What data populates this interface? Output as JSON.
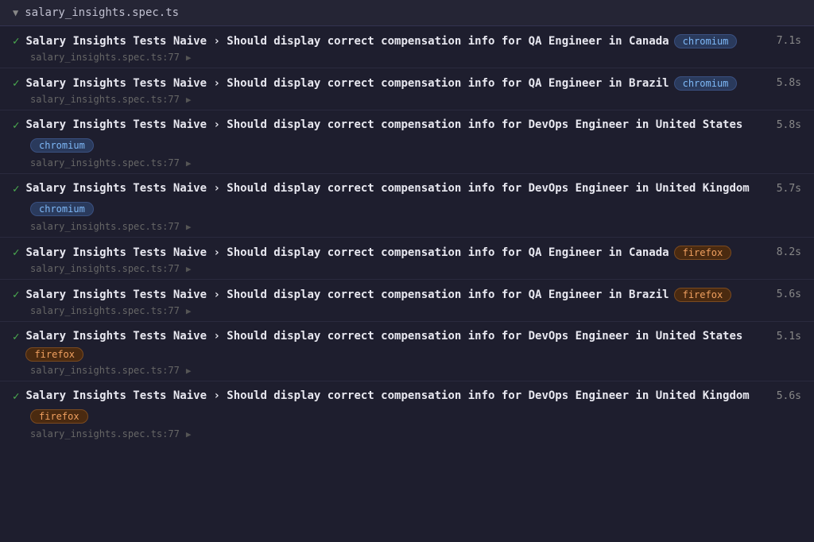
{
  "file": {
    "name": "salary_insights.spec.ts",
    "collapse_icon": "▼"
  },
  "tests": [
    {
      "id": 1,
      "title_prefix": "Salary Insights Tests Naive",
      "title_suffix": "Should display correct compensation info for QA Engineer in Canada",
      "browser": "chromium",
      "badge_type": "chromium",
      "duration": "7.1s",
      "file_ref": "salary_insights.spec.ts:77",
      "badge_inline": true
    },
    {
      "id": 2,
      "title_prefix": "Salary Insights Tests Naive",
      "title_suffix": "Should display correct compensation info for QA Engineer in Brazil",
      "browser": "chromium",
      "badge_type": "chromium",
      "duration": "5.8s",
      "file_ref": "salary_insights.spec.ts:77",
      "badge_inline": true
    },
    {
      "id": 3,
      "title_prefix": "Salary Insights Tests Naive",
      "title_suffix": "Should display correct compensation info for DevOps Engineer in United States",
      "browser": "chromium",
      "badge_type": "chromium",
      "duration": "5.8s",
      "file_ref": "salary_insights.spec.ts:77",
      "badge_inline": false
    },
    {
      "id": 4,
      "title_prefix": "Salary Insights Tests Naive",
      "title_suffix": "Should display correct compensation info for DevOps Engineer in United Kingdom",
      "browser": "chromium",
      "badge_type": "chromium",
      "duration": "5.7s",
      "file_ref": "salary_insights.spec.ts:77",
      "badge_inline": false
    },
    {
      "id": 5,
      "title_prefix": "Salary Insights Tests Naive",
      "title_suffix": "Should display correct compensation info for QA Engineer in Canada",
      "browser": "firefox",
      "badge_type": "firefox",
      "duration": "8.2s",
      "file_ref": "salary_insights.spec.ts:77",
      "badge_inline": true
    },
    {
      "id": 6,
      "title_prefix": "Salary Insights Tests Naive",
      "title_suffix": "Should display correct compensation info for QA Engineer in Brazil",
      "browser": "firefox",
      "badge_type": "firefox",
      "duration": "5.6s",
      "file_ref": "salary_insights.spec.ts:77",
      "badge_inline": true
    },
    {
      "id": 7,
      "title_prefix": "Salary Insights Tests Naive",
      "title_suffix": "Should display correct compensation info for DevOps Engineer in United States",
      "browser": "firefox",
      "badge_type": "firefox",
      "duration": "5.1s",
      "file_ref": "salary_insights.spec.ts:77",
      "badge_inline": true
    },
    {
      "id": 8,
      "title_prefix": "Salary Insights Tests Naive",
      "title_suffix": "Should display correct compensation info for DevOps Engineer in United Kingdom",
      "browser": "firefox",
      "badge_type": "firefox",
      "duration": "5.6s",
      "file_ref": "salary_insights.spec.ts:77",
      "badge_inline": false
    }
  ],
  "labels": {
    "check": "✓",
    "arrow": "›",
    "play": "▶",
    "collapse": "▼"
  }
}
